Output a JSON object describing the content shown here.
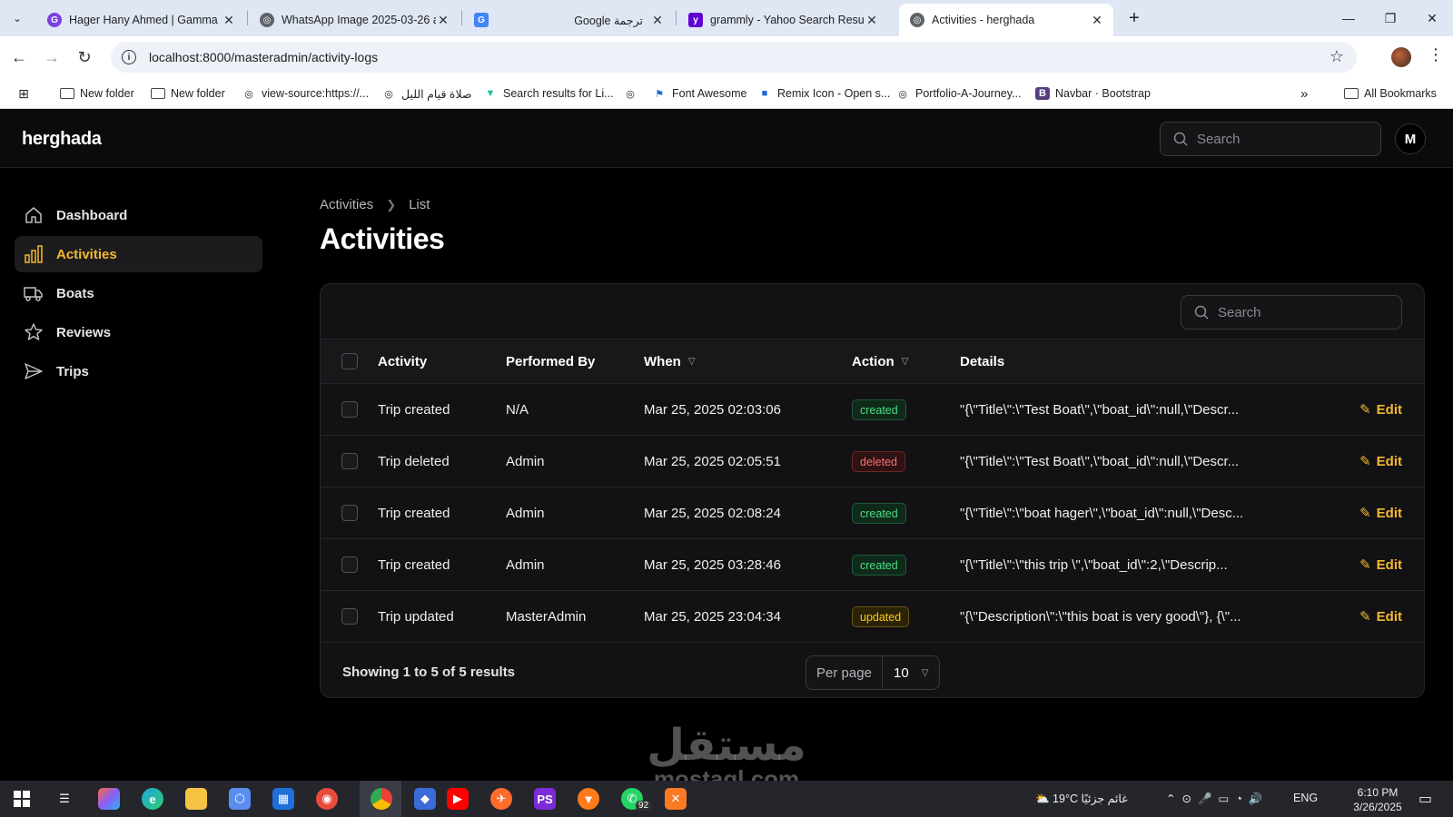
{
  "browser": {
    "tabs": [
      {
        "title": "Hager Hany Ahmed | Gamma",
        "color": "#7b3fe4"
      },
      {
        "title": "WhatsApp Image 2025-03-26 a",
        "color": "#5f6368"
      },
      {
        "title": "Google ترجمة",
        "color": "#4285f4"
      },
      {
        "title": "grammly - Yahoo Search Result",
        "color": "#6001d2"
      },
      {
        "title": "Activities - herghada",
        "color": "#5f6368"
      }
    ],
    "url": "localhost:8000/masteradmin/activity-logs",
    "bookmarks": [
      "New folder",
      "New folder",
      "view-source:https://...",
      "صلاة قيام الليل",
      "Search results for Li...",
      "Font Awesome",
      "Remix Icon - Open s...",
      "Portfolio-A-Journey...",
      "Navbar · Bootstrap",
      "All Bookmarks"
    ]
  },
  "app": {
    "brand": "herghada",
    "search_placeholder": "Search",
    "avatar_initial": "M"
  },
  "sidebar": {
    "items": [
      {
        "label": "Dashboard",
        "icon": "home-icon",
        "active": false
      },
      {
        "label": "Activities",
        "icon": "bar-chart-icon",
        "active": true
      },
      {
        "label": "Boats",
        "icon": "truck-icon",
        "active": false
      },
      {
        "label": "Reviews",
        "icon": "star-icon",
        "active": false
      },
      {
        "label": "Trips",
        "icon": "paper-plane-icon",
        "active": false
      }
    ]
  },
  "page": {
    "breadcrumb": [
      "Activities",
      "List"
    ],
    "title": "Activities"
  },
  "table": {
    "search_placeholder": "Search",
    "columns": [
      "Activity",
      "Performed By",
      "When",
      "Action",
      "Details"
    ],
    "rows": [
      {
        "activity": "Trip created",
        "by": "N/A",
        "when": "Mar 25, 2025 02:03:06",
        "action": "created",
        "details": "\"{\\\"Title\\\":\\\"Test Boat\\\",\\\"boat_id\\\":null,\\\"Descr...",
        "edit": "Edit"
      },
      {
        "activity": "Trip deleted",
        "by": "Admin",
        "when": "Mar 25, 2025 02:05:51",
        "action": "deleted",
        "details": "\"{\\\"Title\\\":\\\"Test Boat\\\",\\\"boat_id\\\":null,\\\"Descr...",
        "edit": "Edit"
      },
      {
        "activity": "Trip created",
        "by": "Admin",
        "when": "Mar 25, 2025 02:08:24",
        "action": "created",
        "details": "\"{\\\"Title\\\":\\\"boat hager\\\",\\\"boat_id\\\":null,\\\"Desc...",
        "edit": "Edit"
      },
      {
        "activity": "Trip created",
        "by": "Admin",
        "when": "Mar 25, 2025 03:28:46",
        "action": "created",
        "details": "\"{\\\"Title\\\":\\\"this trip \\\",\\\"boat_id\\\":2,\\\"Descrip...",
        "edit": "Edit"
      },
      {
        "activity": "Trip updated",
        "by": "MasterAdmin",
        "when": "Mar 25, 2025 23:04:34",
        "action": "updated",
        "details": "\"{\\\"Description\\\":\\\"this boat is very good\\\"}, {\\\"...",
        "edit": "Edit"
      }
    ],
    "showing": "Showing 1 to 5 of 5 results",
    "per_page_label": "Per page",
    "per_page_value": "10"
  },
  "watermark": {
    "line1": "مستقل",
    "line2": "mostaql.com"
  },
  "taskbar": {
    "weather": "19°C  غائم جزئيًا",
    "lang": "ENG",
    "time": "6:10 PM",
    "date": "3/26/2025",
    "whatsapp_badge": "92"
  },
  "colors": {
    "accent": "#f5b82e",
    "created": "#4ade80",
    "deleted": "#f87171",
    "updated": "#facc15"
  }
}
